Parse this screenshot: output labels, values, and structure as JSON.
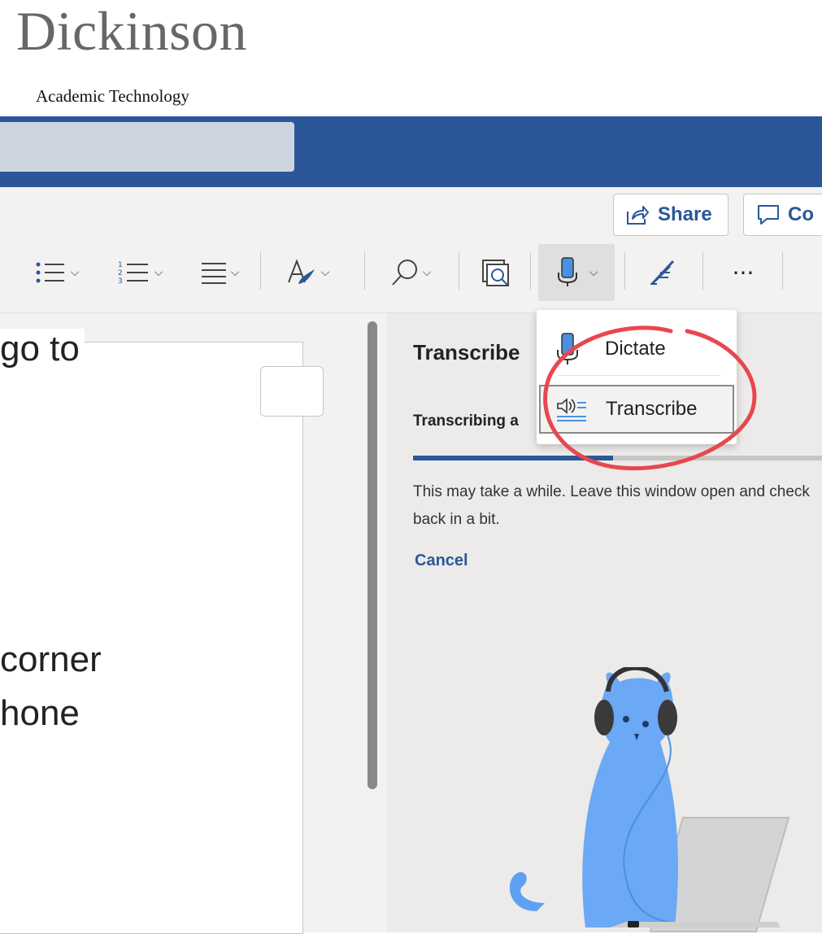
{
  "brand": {
    "name": "Dickinson",
    "subtitle": "Academic Technology"
  },
  "header": {
    "share_label": "Share",
    "comments_label": "Co"
  },
  "toolbar": {
    "tools": [
      "bullets-icon",
      "numbering-icon",
      "align-icon",
      "styles-icon",
      "find-icon",
      "editor-icon",
      "dictate-icon",
      "rewrite-icon",
      "more-icon"
    ],
    "more_label": "···"
  },
  "document": {
    "lines": [
      "go to",
      "corner",
      "hone"
    ]
  },
  "dropdown": {
    "items": [
      {
        "label": "Dictate",
        "icon": "microphone-icon"
      },
      {
        "label": "Transcribe",
        "icon": "transcribe-icon"
      }
    ]
  },
  "pane": {
    "title": "Transcribe",
    "subtitle": "Transcribing a",
    "progress": 0.49,
    "message": "This may take a while. Leave this window open and check back in a bit.",
    "cancel_label": "Cancel"
  },
  "colors": {
    "brand": "#2b579a",
    "annotation": "#e8474f"
  }
}
